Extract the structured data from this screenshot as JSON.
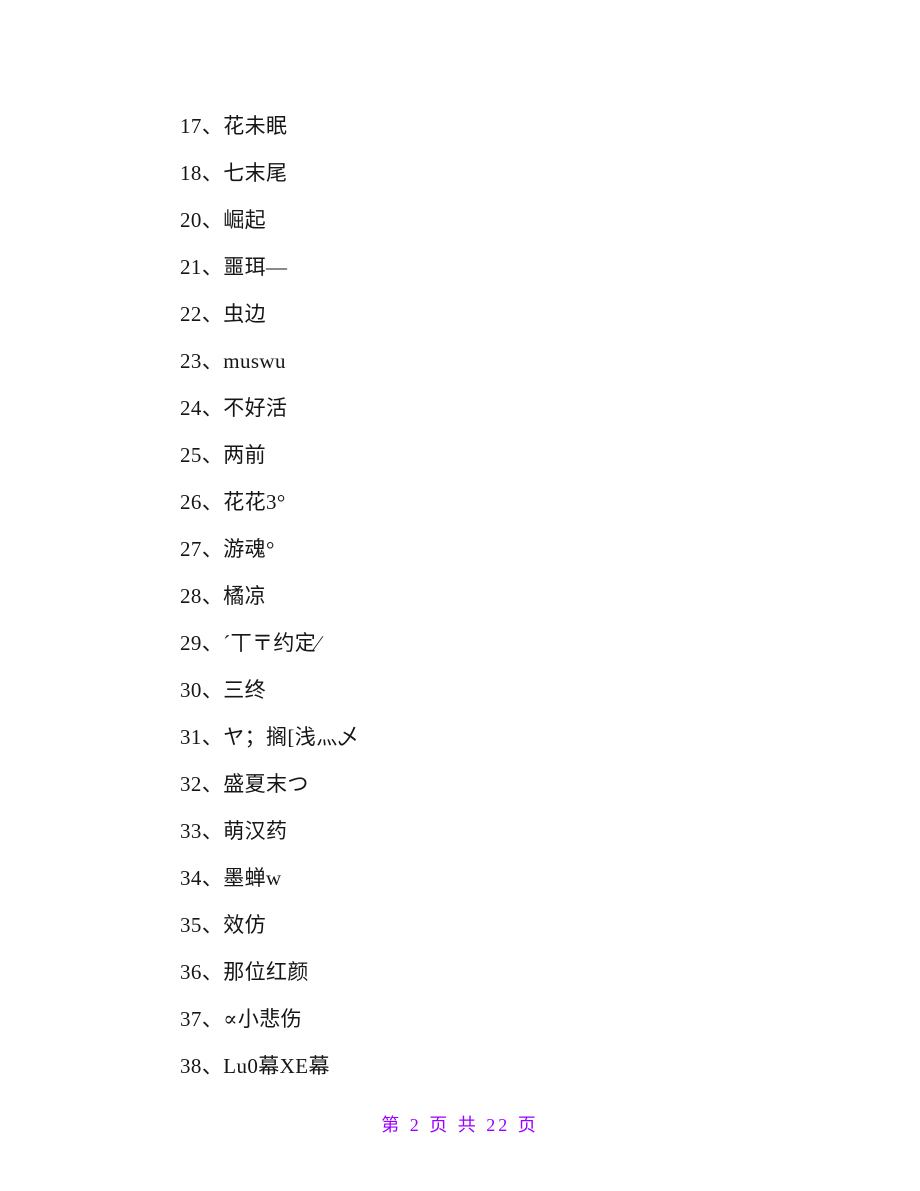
{
  "page": {
    "background_color": "#ffffff",
    "text_color": "#161616"
  },
  "list": {
    "entries": [
      {
        "number": "17",
        "separator": "、",
        "text": "花未眠"
      },
      {
        "number": "18",
        "separator": "、",
        "text": "七末尾"
      },
      {
        "number": "20",
        "separator": "、",
        "text": "崛起"
      },
      {
        "number": "21",
        "separator": "、",
        "text": "噩珥—"
      },
      {
        "number": "22",
        "separator": "、",
        "text": "虫边"
      },
      {
        "number": "23",
        "separator": "、",
        "text": "muswu"
      },
      {
        "number": "24",
        "separator": "、",
        "text": "不好活"
      },
      {
        "number": "25",
        "separator": "、",
        "text": "两前"
      },
      {
        "number": "26",
        "separator": "、",
        "text": "花花3°"
      },
      {
        "number": "27",
        "separator": "、",
        "text": "游魂°"
      },
      {
        "number": "28",
        "separator": "、",
        "text": "橘凉"
      },
      {
        "number": "29",
        "separator": "、",
        "text": "´丅〒约定∕"
      },
      {
        "number": "30",
        "separator": "、",
        "text": "三终"
      },
      {
        "number": "31",
        "separator": "、",
        "text": "ヤ；搁[浅灬乄"
      },
      {
        "number": "32",
        "separator": "、",
        "text": "盛夏末つ"
      },
      {
        "number": "33",
        "separator": "、",
        "text": "萌汉药"
      },
      {
        "number": "34",
        "separator": "、",
        "text": "墨蝉w"
      },
      {
        "number": "35",
        "separator": "、",
        "text": "效仿"
      },
      {
        "number": "36",
        "separator": "、",
        "text": "那位红颜"
      },
      {
        "number": "37",
        "separator": "、",
        "text": "∝小悲伤"
      },
      {
        "number": "38",
        "separator": "、",
        "text": "Lu0幕XE幕"
      }
    ]
  },
  "footer": {
    "text": "第 2 页 共 22 页",
    "current_page": "2",
    "total_pages": "22",
    "color": "#9900ff"
  }
}
